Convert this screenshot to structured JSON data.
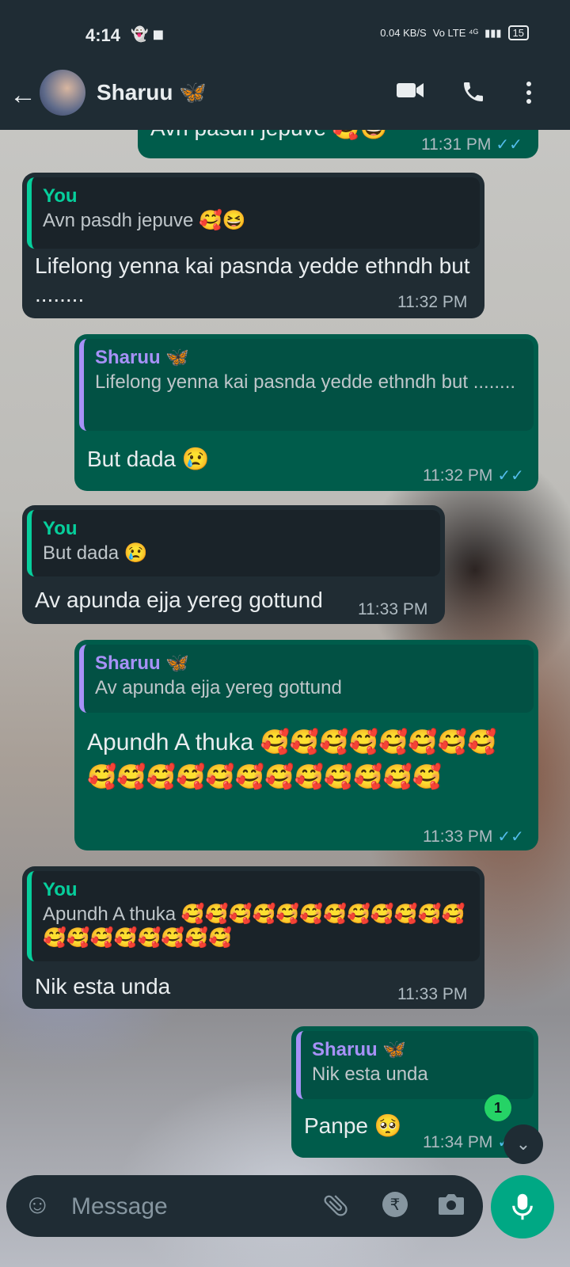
{
  "status_bar": {
    "time": "4:14",
    "left_icons": "👻 ◼",
    "net_speed": "0.04 KB/S",
    "network": "Vo LTE ⁴ᴳ",
    "signal": "▮▮▮",
    "battery": "15"
  },
  "header": {
    "contact_name": "Sharuu 🦋",
    "back_icon": "back-arrow",
    "video_icon": "video-camera",
    "call_icon": "phone",
    "menu_icon": "more-vertical"
  },
  "messages": [
    {
      "direction": "out",
      "text": "Avn pasdh jepuve 🥰😆",
      "time": "11:31 PM",
      "ticks": "✓✓"
    },
    {
      "direction": "in",
      "quote_author": "You",
      "quote_text": "Avn pasdh jepuve 🥰😆",
      "text": "Lifelong yenna kai pasnda yedde ethndh but ........",
      "time": "11:32 PM"
    },
    {
      "direction": "out",
      "quote_author": "Sharuu 🦋",
      "quote_text": "Lifelong yenna kai pasnda yedde ethndh but ........",
      "text": "But dada 😢",
      "time": "11:32 PM",
      "ticks": "✓✓"
    },
    {
      "direction": "in",
      "quote_author": "You",
      "quote_text": "But dada 😢",
      "text": "Av apunda ejja yereg gottund",
      "time": "11:33 PM"
    },
    {
      "direction": "out",
      "quote_author": "Sharuu 🦋",
      "quote_text": "Av apunda ejja yereg gottund",
      "text": "Apundh A thuka 🥰🥰🥰🥰🥰🥰🥰🥰🥰🥰🥰🥰🥰🥰🥰🥰🥰🥰🥰🥰",
      "time": "11:33 PM",
      "ticks": "✓✓"
    },
    {
      "direction": "in",
      "quote_author": "You",
      "quote_text": "Apundh A thuka 🥰🥰🥰🥰🥰🥰🥰🥰🥰🥰🥰🥰🥰🥰🥰🥰🥰🥰🥰🥰",
      "text": "Nik esta unda",
      "time": "11:33 PM"
    },
    {
      "direction": "out",
      "quote_author": "Sharuu 🦋",
      "quote_text": "Nik esta unda",
      "text": "Panpe 🥺",
      "time": "11:34 PM",
      "ticks": "✓✓"
    }
  ],
  "unread_badge": "1",
  "scroll_down_icon": "chevron-double-down",
  "composer": {
    "placeholder": "Message",
    "emoji_icon": "emoji",
    "attach_icon": "paperclip",
    "payment_icon": "rupee",
    "camera_icon": "camera",
    "mic_icon": "microphone"
  },
  "colors": {
    "header": "#1f2c34",
    "incoming": "#202c33",
    "outgoing": "#005c4b",
    "accent": "#00a884",
    "read_ticks": "#53bdeb"
  }
}
